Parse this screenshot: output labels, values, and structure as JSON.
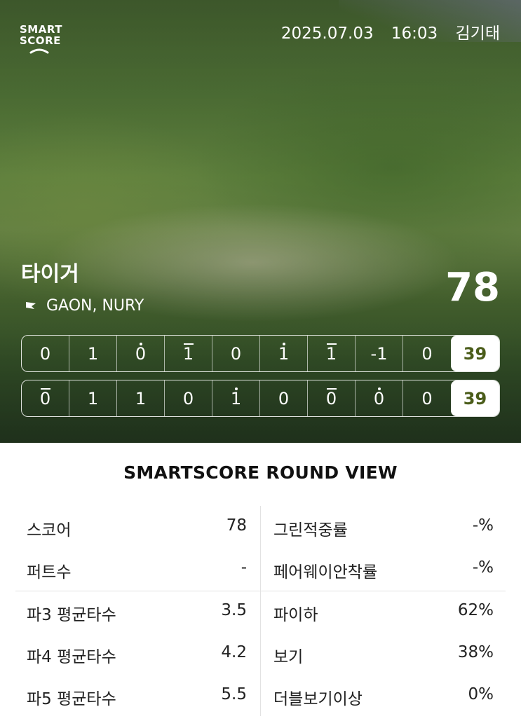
{
  "app": {
    "logo_line1": "SMART",
    "logo_line2": "SCORE"
  },
  "header": {
    "date": "2025.07.03",
    "time": "16:03",
    "player": "김기태"
  },
  "round": {
    "course": "타이거",
    "tees": "GAON, NURY",
    "total": "78"
  },
  "scorecard": {
    "front": {
      "holes": [
        {
          "score": "0",
          "mark": ""
        },
        {
          "score": "1",
          "mark": ""
        },
        {
          "score": "0",
          "mark": "dot"
        },
        {
          "score": "1",
          "mark": "bar"
        },
        {
          "score": "0",
          "mark": ""
        },
        {
          "score": "1",
          "mark": "dot"
        },
        {
          "score": "1",
          "mark": "bar"
        },
        {
          "score": "-1",
          "mark": ""
        },
        {
          "score": "0",
          "mark": ""
        }
      ],
      "total": "39"
    },
    "back": {
      "holes": [
        {
          "score": "0",
          "mark": "bar"
        },
        {
          "score": "1",
          "mark": ""
        },
        {
          "score": "1",
          "mark": ""
        },
        {
          "score": "0",
          "mark": ""
        },
        {
          "score": "1",
          "mark": "dot"
        },
        {
          "score": "0",
          "mark": ""
        },
        {
          "score": "0",
          "mark": "bar"
        },
        {
          "score": "0",
          "mark": "dot"
        },
        {
          "score": "0",
          "mark": ""
        }
      ],
      "total": "39"
    }
  },
  "summary": {
    "title": "SMARTSCORE ROUND VIEW",
    "left": [
      {
        "label": "스코어",
        "value": "78"
      },
      {
        "label": "퍼트수",
        "value": "-"
      },
      {
        "label": "파3 평균타수",
        "value": "3.5"
      },
      {
        "label": "파4 평균타수",
        "value": "4.2"
      },
      {
        "label": "파5 평균타수",
        "value": "5.5"
      }
    ],
    "right": [
      {
        "label": "그린적중률",
        "value": "-%"
      },
      {
        "label": "페어웨이안착률",
        "value": "-%"
      },
      {
        "label": "파이하",
        "value": "62%"
      },
      {
        "label": "보기",
        "value": "38%"
      },
      {
        "label": "더블보기이상",
        "value": "0%"
      }
    ]
  },
  "icons": {
    "flag": "flag-icon",
    "phone": "phone-swoosh-icon"
  }
}
